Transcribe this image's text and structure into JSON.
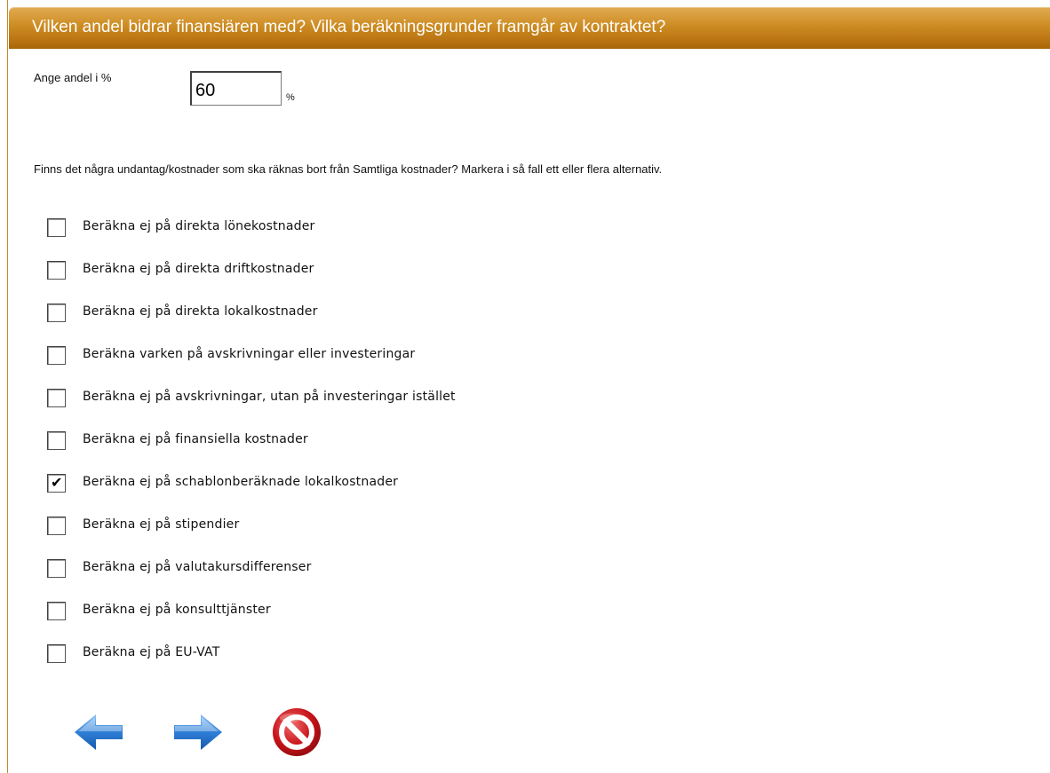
{
  "header": {
    "title": "Vilken andel bidrar finansiären med? Vilka beräkningsgrunder framgår av kontraktet?"
  },
  "share": {
    "label": "Ange andel i %",
    "value": "60",
    "unit": "%"
  },
  "exclusions": {
    "question": "Finns det några undantag/kostnader som ska räknas bort från Samtliga kostnader? Markera i så fall ett eller flera alternativ.",
    "options": [
      {
        "label": "Beräkna ej på direkta lönekostnader",
        "checked": false
      },
      {
        "label": "Beräkna ej på direkta driftkostnader",
        "checked": false
      },
      {
        "label": "Beräkna ej på direkta lokalkostnader",
        "checked": false
      },
      {
        "label": "Beräkna varken på avskrivningar eller investeringar",
        "checked": false
      },
      {
        "label": "Beräkna ej på avskrivningar, utan på investeringar istället",
        "checked": false
      },
      {
        "label": "Beräkna ej på finansiella kostnader",
        "checked": false
      },
      {
        "label": "Beräkna ej på schablonberäknade lokalkostnader",
        "checked": true
      },
      {
        "label": "Beräkna ej på stipendier",
        "checked": false
      },
      {
        "label": "Beräkna ej på valutakursdifferenser",
        "checked": false
      },
      {
        "label": "Beräkna ej på konsulttjänster",
        "checked": false
      },
      {
        "label": "Beräkna ej på EU-VAT",
        "checked": false
      }
    ]
  },
  "navigation": {
    "back_icon": "arrow-left-icon",
    "forward_icon": "arrow-right-icon",
    "cancel_icon": "cancel-icon"
  },
  "colors": {
    "header_gold": "#c8861d",
    "arrow_blue": "#2f7fd6",
    "cancel_red": "#c8141a"
  }
}
